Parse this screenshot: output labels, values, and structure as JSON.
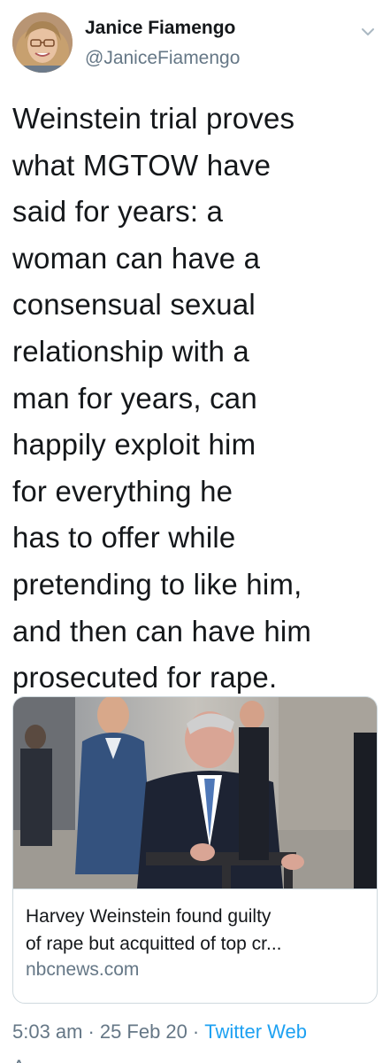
{
  "author": {
    "display_name": "Janice Fiamengo",
    "handle": "@JaniceFiamengo",
    "avatar_icon": "profile-photo"
  },
  "menu": {
    "icon": "chevron-down-icon"
  },
  "tweet": {
    "lines": [
      "Weinstein trial proves",
      "what MGTOW have",
      "said for years: a",
      "woman can have a",
      "consensual sexual",
      "relationship with a",
      "man for years, can",
      "happily exploit him",
      "for everything he",
      "has to offer while",
      "pretending to like him,",
      "and then can have him",
      "prosecuted for rape."
    ]
  },
  "card": {
    "title_lines": [
      "Harvey Weinstein found guilty",
      "of rape but acquitted of top cr..."
    ],
    "domain": "nbcnews.com"
  },
  "meta": {
    "time": "5:03 am",
    "separator": "·",
    "date": "25 Feb 20",
    "source": "Twitter Web",
    "cut_off": "A"
  },
  "colors": {
    "text": "#14171a",
    "secondary": "#657786",
    "link": "#1da1f2",
    "border": "#cfd9de"
  }
}
